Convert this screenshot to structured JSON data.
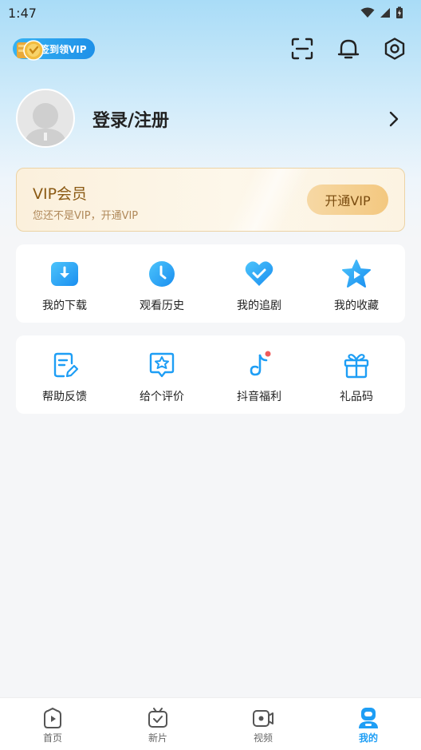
{
  "status_bar": {
    "time": "1:47"
  },
  "header": {
    "sign_vip_label": "签到领VIP"
  },
  "profile": {
    "login_label": "登录/注册"
  },
  "vip_card": {
    "title": "VIP会员",
    "subtitle": "您还不是VIP，开通VIP",
    "button_label": "开通VIP"
  },
  "quick_actions": [
    {
      "label": "我的下载",
      "icon": "download-icon"
    },
    {
      "label": "观看历史",
      "icon": "history-clock-icon"
    },
    {
      "label": "我的追剧",
      "icon": "heart-check-icon"
    },
    {
      "label": "我的收藏",
      "icon": "star-play-icon"
    }
  ],
  "services": [
    {
      "label": "帮助反馈",
      "icon": "feedback-icon"
    },
    {
      "label": "给个评价",
      "icon": "rating-star-icon"
    },
    {
      "label": "抖音福利",
      "icon": "douyin-icon"
    },
    {
      "label": "礼品码",
      "icon": "gift-icon"
    }
  ],
  "tabbar": [
    {
      "label": "首页",
      "icon": "home-play-icon"
    },
    {
      "label": "新片",
      "icon": "tv-new-icon"
    },
    {
      "label": "视频",
      "icon": "video-camera-icon"
    },
    {
      "label": "我的",
      "icon": "profile-icon",
      "active": true
    }
  ],
  "colors": {
    "accent": "#1e9ef5",
    "vip_gold": "#8b5a14",
    "background": "#f5f6f8"
  }
}
